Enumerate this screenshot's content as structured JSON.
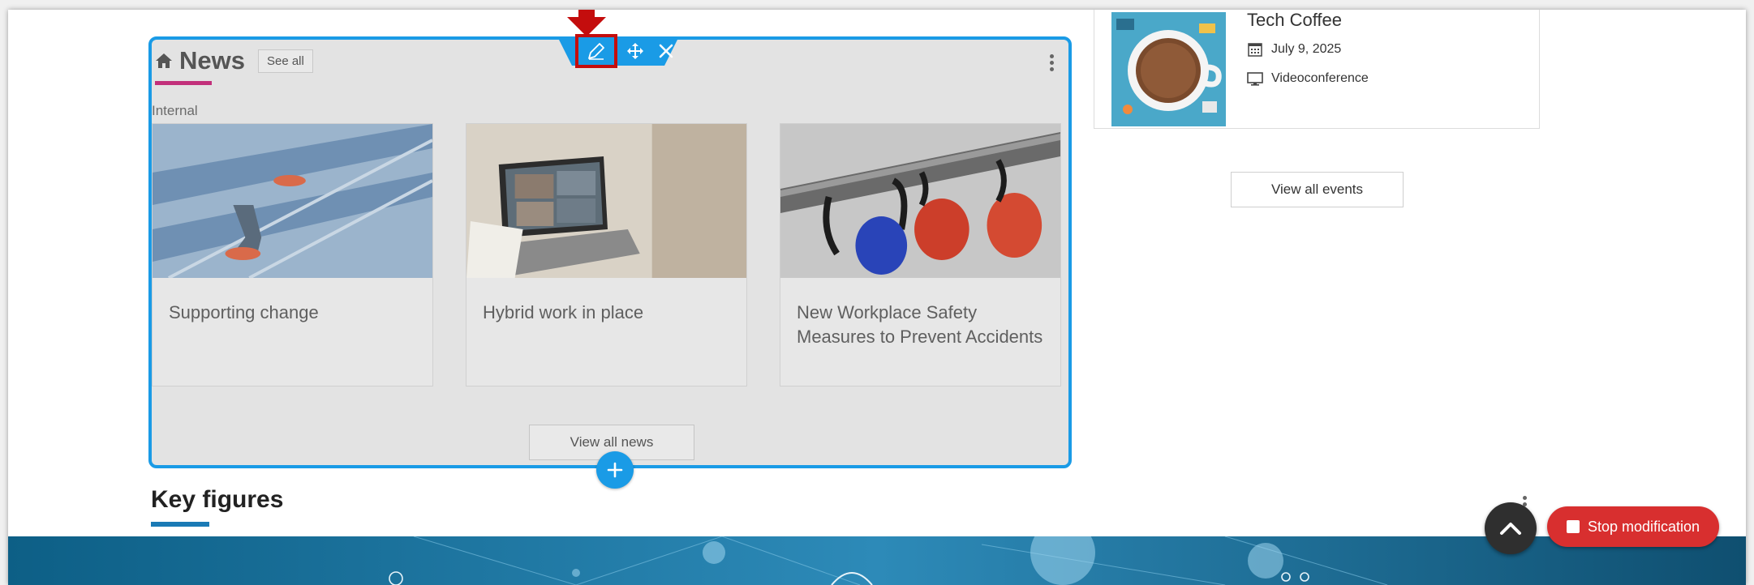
{
  "news": {
    "title": "News",
    "see_all_label": "See all",
    "category": "Internal",
    "cards": [
      {
        "title": "Supporting change"
      },
      {
        "title": "Hybrid work in place"
      },
      {
        "title": "New Workplace Safety Measures to Prevent Accidents"
      }
    ],
    "view_all_label": "View all news"
  },
  "toolbar": {
    "icons": [
      "pencil-icon",
      "move-icon",
      "close-icon"
    ],
    "accent": "#1a9be6",
    "highlight": "#c40d0d"
  },
  "events": {
    "title": "Tech Coffee",
    "date": "July 9, 2025",
    "location": "Videoconference",
    "view_all_label": "View all events"
  },
  "key_figures": {
    "title": "Key figures"
  },
  "actions": {
    "stop_label": "Stop modification",
    "stop_color": "#d82f2f"
  }
}
